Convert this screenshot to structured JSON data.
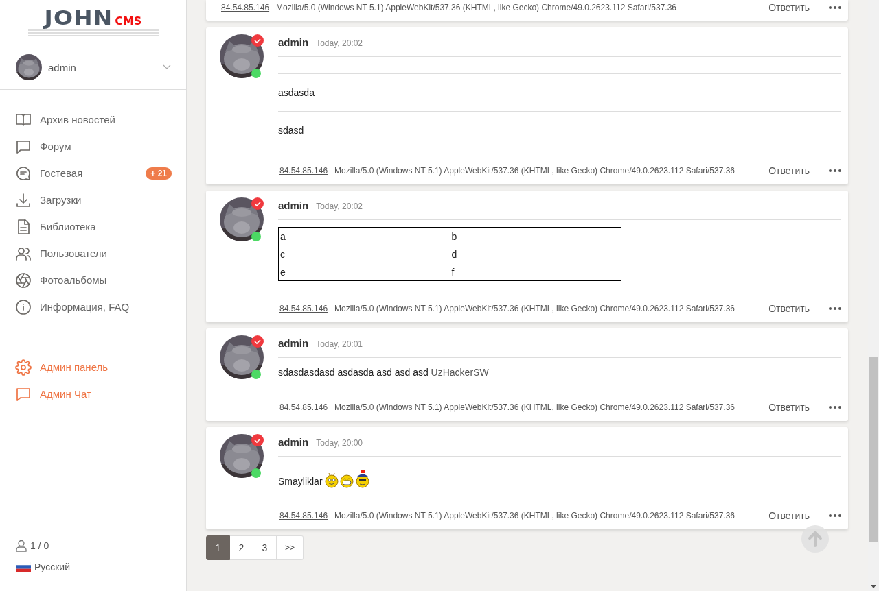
{
  "logo": {
    "main": "JOHN",
    "accent": "CMS"
  },
  "user": {
    "name": "admin"
  },
  "nav": [
    {
      "label": "Архив новостей"
    },
    {
      "label": "Форум"
    },
    {
      "label": "Гостевая",
      "badge": "+ 21"
    },
    {
      "label": "Загрузки"
    },
    {
      "label": "Библиотека"
    },
    {
      "label": "Пользователи"
    },
    {
      "label": "Фотоальбомы"
    },
    {
      "label": "Информация, FAQ"
    }
  ],
  "admin_nav": [
    {
      "label": "Админ панель"
    },
    {
      "label": "Админ Чат"
    }
  ],
  "footer": {
    "online": "1 / 0",
    "language": "Русский"
  },
  "posts": [
    {
      "ip": "84.54.85.146",
      "user_agent": "Mozilla/5.0 (Windows NT 5.1) AppleWebKit/537.36 (KHTML, like Gecko) Chrome/49.0.2623.112 Safari/537.36",
      "reply": "Ответить"
    },
    {
      "author": "admin",
      "time": "Today, 20:02",
      "verified": true,
      "online": true,
      "body": [
        {
          "kind": "rule"
        },
        {
          "kind": "text",
          "text": "asdasda"
        },
        {
          "kind": "rule"
        },
        {
          "kind": "text",
          "text": "sdasd"
        }
      ],
      "ip": "84.54.85.146",
      "user_agent": "Mozilla/5.0 (Windows NT 5.1) AppleWebKit/537.36 (KHTML, like Gecko) Chrome/49.0.2623.112 Safari/537.36",
      "reply": "Ответить"
    },
    {
      "author": "admin",
      "time": "Today, 20:02",
      "verified": true,
      "online": true,
      "body": [
        {
          "kind": "table",
          "rows": [
            [
              "a",
              "b"
            ],
            [
              "c",
              "d"
            ],
            [
              "e",
              "f"
            ]
          ]
        }
      ],
      "ip": "84.54.85.146",
      "user_agent": "Mozilla/5.0 (Windows NT 5.1) AppleWebKit/537.36 (KHTML, like Gecko) Chrome/49.0.2623.112 Safari/537.36",
      "reply": "Ответить"
    },
    {
      "author": "admin",
      "time": "Today, 20:01",
      "verified": true,
      "online": true,
      "body": [
        {
          "kind": "text",
          "text": "sdasdasdasd asdasda asd asd asd",
          "link": "UzHackerSW"
        }
      ],
      "ip": "84.54.85.146",
      "user_agent": "Mozilla/5.0 (Windows NT 5.1) AppleWebKit/537.36 (KHTML, like Gecko) Chrome/49.0.2623.112 Safari/537.36",
      "reply": "Ответить"
    },
    {
      "author": "admin",
      "time": "Today, 20:00",
      "verified": true,
      "online": true,
      "body": [
        {
          "kind": "smileys",
          "text": "Smayliklar"
        }
      ],
      "ip": "84.54.85.146",
      "user_agent": "Mozilla/5.0 (Windows NT 5.1) AppleWebKit/537.36 (KHTML, like Gecko) Chrome/49.0.2623.112 Safari/537.36",
      "reply": "Ответить"
    }
  ],
  "pagination": [
    {
      "label": "1",
      "selected": true
    },
    {
      "label": "2",
      "selected": false
    },
    {
      "label": "3",
      "selected": false
    },
    {
      "label": ">>",
      "selected": false
    }
  ]
}
